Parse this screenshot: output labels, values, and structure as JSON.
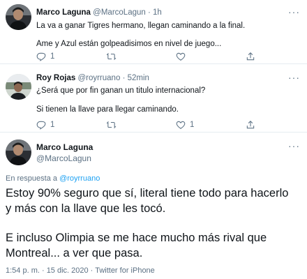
{
  "tweets": [
    {
      "name": "Marco Laguna",
      "handle": "@MarcoLagun",
      "separator": "·",
      "time": "1h",
      "lines": [
        "La va a ganar Tigres hermano, llegan caminando a la final.",
        "Ame y Azul están golpeadisimos en nivel de juego..."
      ],
      "reply_count": "1",
      "retweet_count": "",
      "like_count": ""
    },
    {
      "name": "Roy Rojas",
      "handle": "@royrruano",
      "separator": "·",
      "time": "52min",
      "lines": [
        "¿Será que por fin ganan un titulo internacional?",
        "Si tienen la llave para llegar caminando."
      ],
      "reply_count": "1",
      "retweet_count": "",
      "like_count": "1"
    }
  ],
  "main_tweet": {
    "name": "Marco Laguna",
    "handle": "@MarcoLagun",
    "reply_prefix": "En respuesta a",
    "reply_mention": "@royrruano",
    "lines": [
      "Estoy 90% seguro que sí, literal tiene todo para hacerlo",
      "y más con la llave que les tocó.",
      "E incluso Olimpia se me hace mucho más rival que",
      "Montreal... a ver que pasa."
    ],
    "timestamp": "1:54 p. m. · 15 dic. 2020 · Twitter for iPhone"
  },
  "icons": {
    "reply": "reply-icon",
    "retweet": "retweet-icon",
    "like": "heart-icon",
    "share": "share-icon",
    "more": "more-dots-icon"
  },
  "colors": {
    "link": "#1da1f2",
    "muted": "#5b7083",
    "text": "#0f1419",
    "divider": "#e6ecf0"
  }
}
